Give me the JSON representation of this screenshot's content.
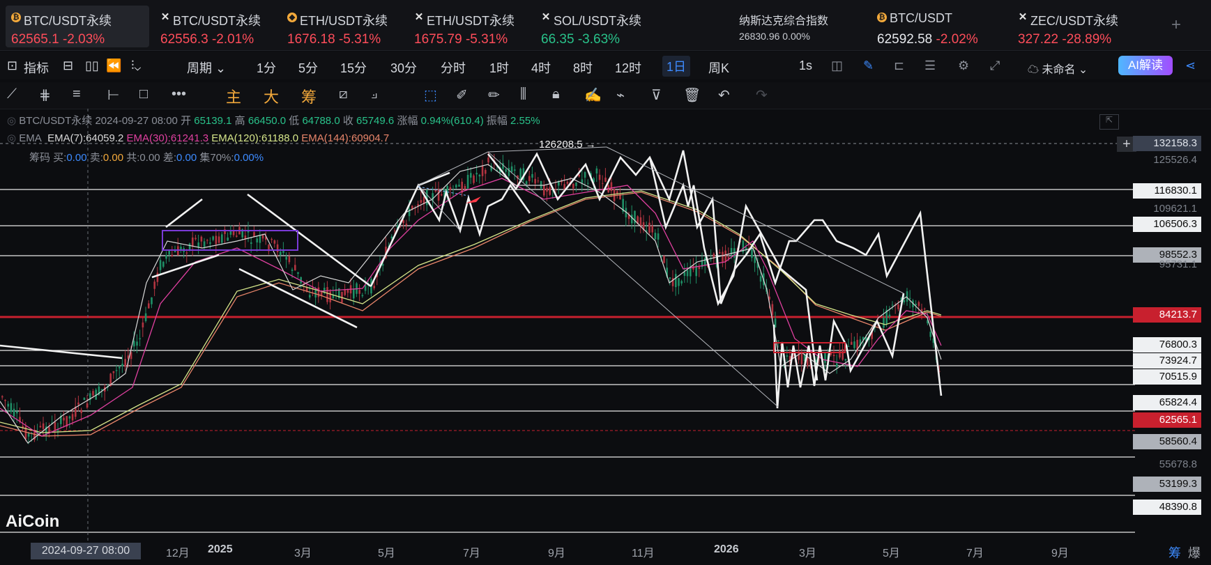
{
  "tabs": [
    {
      "name": "BTC/USDT永续",
      "price": "62565.1",
      "change": "-2.03%",
      "icon": "coin-icon"
    },
    {
      "name": "BTC/USDT永续",
      "price": "62556.3",
      "change": "-2.01%",
      "icon": "pin-icon"
    },
    {
      "name": "ETH/USDT永续",
      "price": "1676.18",
      "change": "-5.31%",
      "icon": "coin-icon"
    },
    {
      "name": "ETH/USDT永续",
      "price": "1675.79",
      "change": "-5.31%",
      "icon": "pin-icon"
    },
    {
      "name": "SOL/USDT永续",
      "price": "66.35",
      "change": "-3.63%",
      "icon": "pin-icon"
    },
    {
      "name": "纳斯达克综合指数",
      "price": "26830.96",
      "change": "0.00%",
      "icon": ""
    },
    {
      "name": "BTC/USDT",
      "price": "62592.58",
      "change": "-2.02%",
      "icon": "coin-icon"
    },
    {
      "name": "ZEC/USDT永续",
      "price": "327.22",
      "change": "-28.89%",
      "icon": "pin-icon"
    }
  ],
  "add_tab": "+",
  "toolbar": {
    "indicators": "指标",
    "period": "周期",
    "intervals": [
      "1分",
      "5分",
      "15分",
      "30分",
      "分时",
      "1时",
      "4时",
      "8时",
      "12时",
      "1日",
      "周K"
    ],
    "selected_interval": "1日",
    "one_s": "1s",
    "layout_name": "未命名",
    "ai": "AI解读"
  },
  "drawtools": {
    "main": "主",
    "big": "大",
    "chip": "筹"
  },
  "info": {
    "symbol": "BTC/USDT永续",
    "date": "2024-09-27 08:00",
    "open_label": "开",
    "open": "65139.1",
    "high_label": "高",
    "high": "66450.0",
    "low_label": "低",
    "low": "64788.0",
    "close_label": "收",
    "close": "65749.6",
    "chg_label": "涨幅",
    "chg": "0.94%(610.4)",
    "amp_label": "振幅",
    "amp": "2.55%",
    "ema_label": "EMA",
    "ema7": "EMA(7):64059.2",
    "ema30": "EMA(30):61241.3",
    "ema120": "EMA(120):61188.0",
    "ema144": "EMA(144):60904.7",
    "chip_line": "筹码 买:",
    "chip_buy": "0.00",
    "chip_sell_l": "卖:",
    "chip_sell": "0.00",
    "chip_total": "共:0.00",
    "chip_diff_l": "差:",
    "chip_diff": "0.00",
    "chip_conc_l": "集70%:",
    "chip_conc": "0.00%"
  },
  "peak_label": "126208.5 →",
  "price_labels": [
    {
      "v": "132158.3",
      "style": "dark"
    },
    {
      "v": "125526.4",
      "style": "dim"
    },
    {
      "v": "116830.1",
      "style": "white"
    },
    {
      "v": "109621.1",
      "style": "dim"
    },
    {
      "v": "106506.3",
      "style": "white"
    },
    {
      "v": "98552.3",
      "style": "gray"
    },
    {
      "v": "95731.1",
      "style": "dim"
    },
    {
      "v": "84213.7",
      "style": "red"
    },
    {
      "v": "76800.3",
      "style": "white"
    },
    {
      "v": "73924.7",
      "style": "white"
    },
    {
      "v": "70515.9",
      "style": "white"
    },
    {
      "v": "65824.4",
      "style": "white"
    },
    {
      "v": "62565.1",
      "style": "red"
    },
    {
      "v": "58560.4",
      "style": "gray"
    },
    {
      "v": "55678.8",
      "style": "dim"
    },
    {
      "v": "53199.3",
      "style": "gray"
    },
    {
      "v": "48390.8",
      "style": "white"
    }
  ],
  "x_axis": {
    "cursor_date": "2024-09-27 08:00",
    "labels": [
      "12月",
      "2025",
      "3月",
      "5月",
      "7月",
      "9月",
      "11月",
      "2026",
      "3月",
      "5月",
      "7月",
      "9月"
    ],
    "bold": [
      "2025",
      "2026"
    ]
  },
  "bottom_right": [
    "筹",
    "爆"
  ],
  "watermark": "AiCoin",
  "colors": {
    "up": "#29c28a",
    "down": "#ff4d5a",
    "accent": "#3d8bff",
    "ema7": "#d8d8d8",
    "ema30": "#e040a0",
    "ema120": "#d6e68a",
    "ema144": "#e8856a"
  }
}
